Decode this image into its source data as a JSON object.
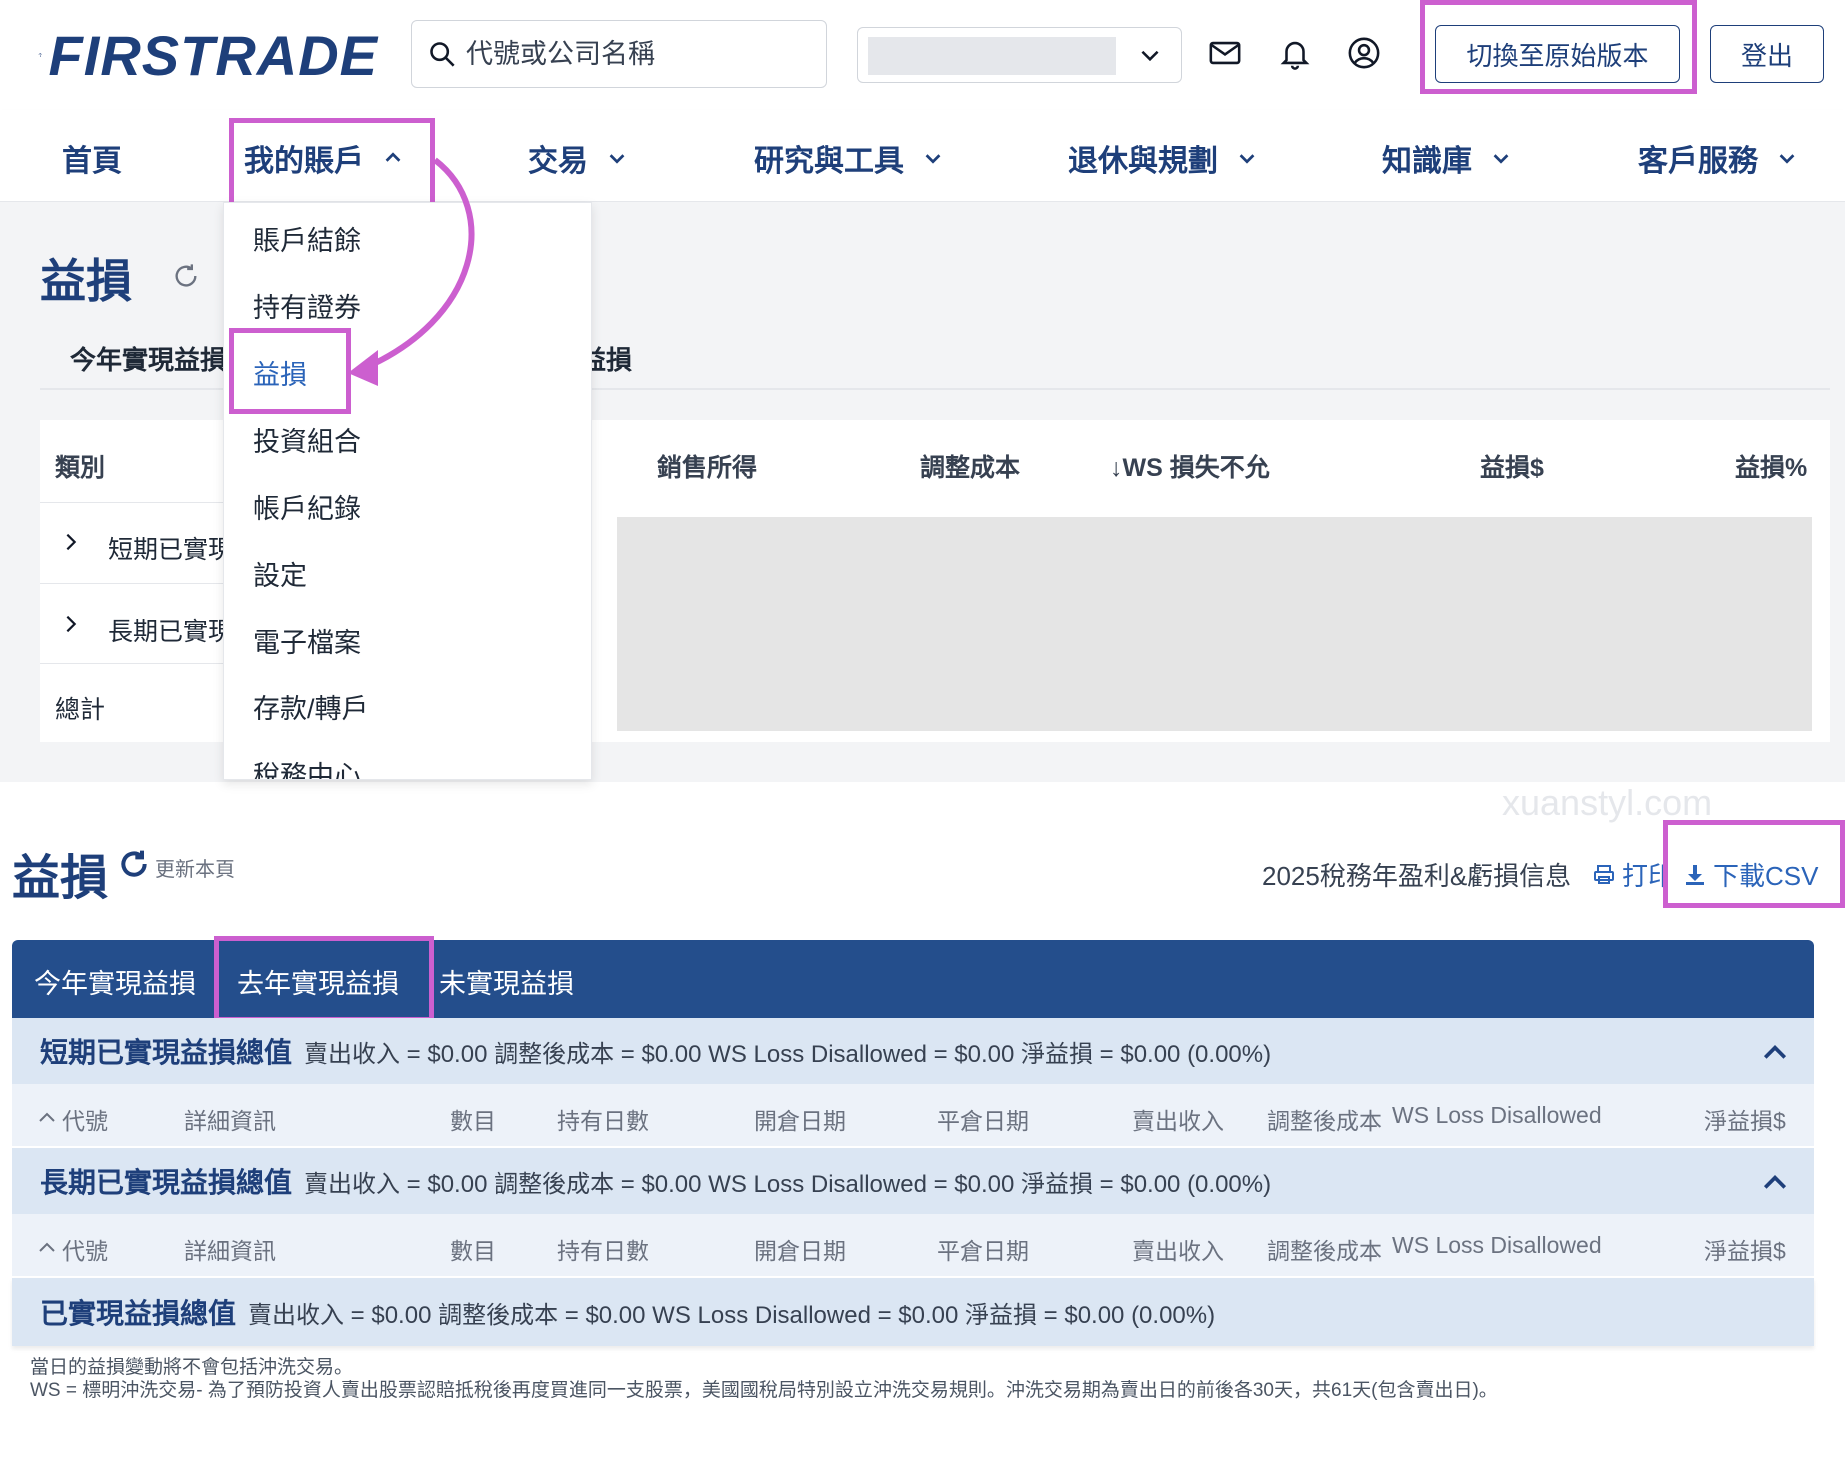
{
  "header": {
    "logo_text": "FIRSTRADE",
    "search_placeholder": "代號或公司名稱",
    "switch_version_label": "切換至原始版本",
    "logout_label": "登出"
  },
  "nav": {
    "items": [
      {
        "label": "首頁"
      },
      {
        "label": "我的賬戶"
      },
      {
        "label": "交易"
      },
      {
        "label": "研究與工具"
      },
      {
        "label": "退休與規劃"
      },
      {
        "label": "知識庫"
      },
      {
        "label": "客戶服務"
      }
    ]
  },
  "dropdown": {
    "items": [
      "賬戶結餘",
      "持有證券",
      "益損",
      "投資組合",
      "帳戶紀錄",
      "設定",
      "電子檔案",
      "存款/轉戶",
      "稅務中心"
    ]
  },
  "upper": {
    "title": "益損",
    "tab_first": "今年實現益損",
    "tab_partial": "益損",
    "table_headers": {
      "category": "類別",
      "proceeds": "銷售所得",
      "adj_cost": "調整成本",
      "ws": "↓WS 損失不允",
      "pl_dollar": "益損$",
      "pl_pct": "益損%"
    },
    "rows": [
      "短期已實現",
      "長期已實現",
      "總計"
    ]
  },
  "lower": {
    "title": "益損",
    "refresh_label": "更新本頁",
    "tax_info": "2025稅務年盈利&虧損信息",
    "print_label": "打印",
    "csv_label": "下載CSV",
    "tabs": [
      "今年實現益損",
      "去年實現益損",
      "未實現益損"
    ],
    "short_term": {
      "title": "短期已實現益損總值",
      "text": "賣出收入 = $0.00  調整後成本 = $0.00  WS Loss Disallowed = $0.00   淨益損 = $0.00 (0.00%)"
    },
    "long_term": {
      "title": "長期已實現益損總值",
      "text": "賣出收入 = $0.00  調整後成本 = $0.00  WS Loss Disallowed = $0.00   淨益損 = $0.00 (0.00%)"
    },
    "total": {
      "title": "已實現益損總值",
      "text": "賣出收入 = $0.00  調整後成本 = $0.00  WS Loss Disallowed = $0.00   淨益損 = $0.00 (0.00%)"
    },
    "columns": [
      "代號",
      "詳細資訊",
      "數目",
      "持有日數",
      "開倉日期",
      "平倉日期",
      "賣出收入",
      "調整後成本",
      "WS Loss Disallowed",
      "淨益損$"
    ],
    "footnote_1": "當日的益損變動將不會包括沖洗交易。",
    "footnote_2": "WS = 標明沖洗交易- 為了預防投資人賣出股票認賠抵稅後再度買進同一支股票，美國國稅局特別設立沖洗交易規則。沖洗交易期為賣出日的前後各30天，共61天(包含賣出日)。"
  },
  "watermark": "xuanstyl.com",
  "colors": {
    "brand": "#1e3f7a",
    "tabbar": "#244e8c",
    "highlight": "#cc5fcf",
    "link": "#2b64b9"
  }
}
